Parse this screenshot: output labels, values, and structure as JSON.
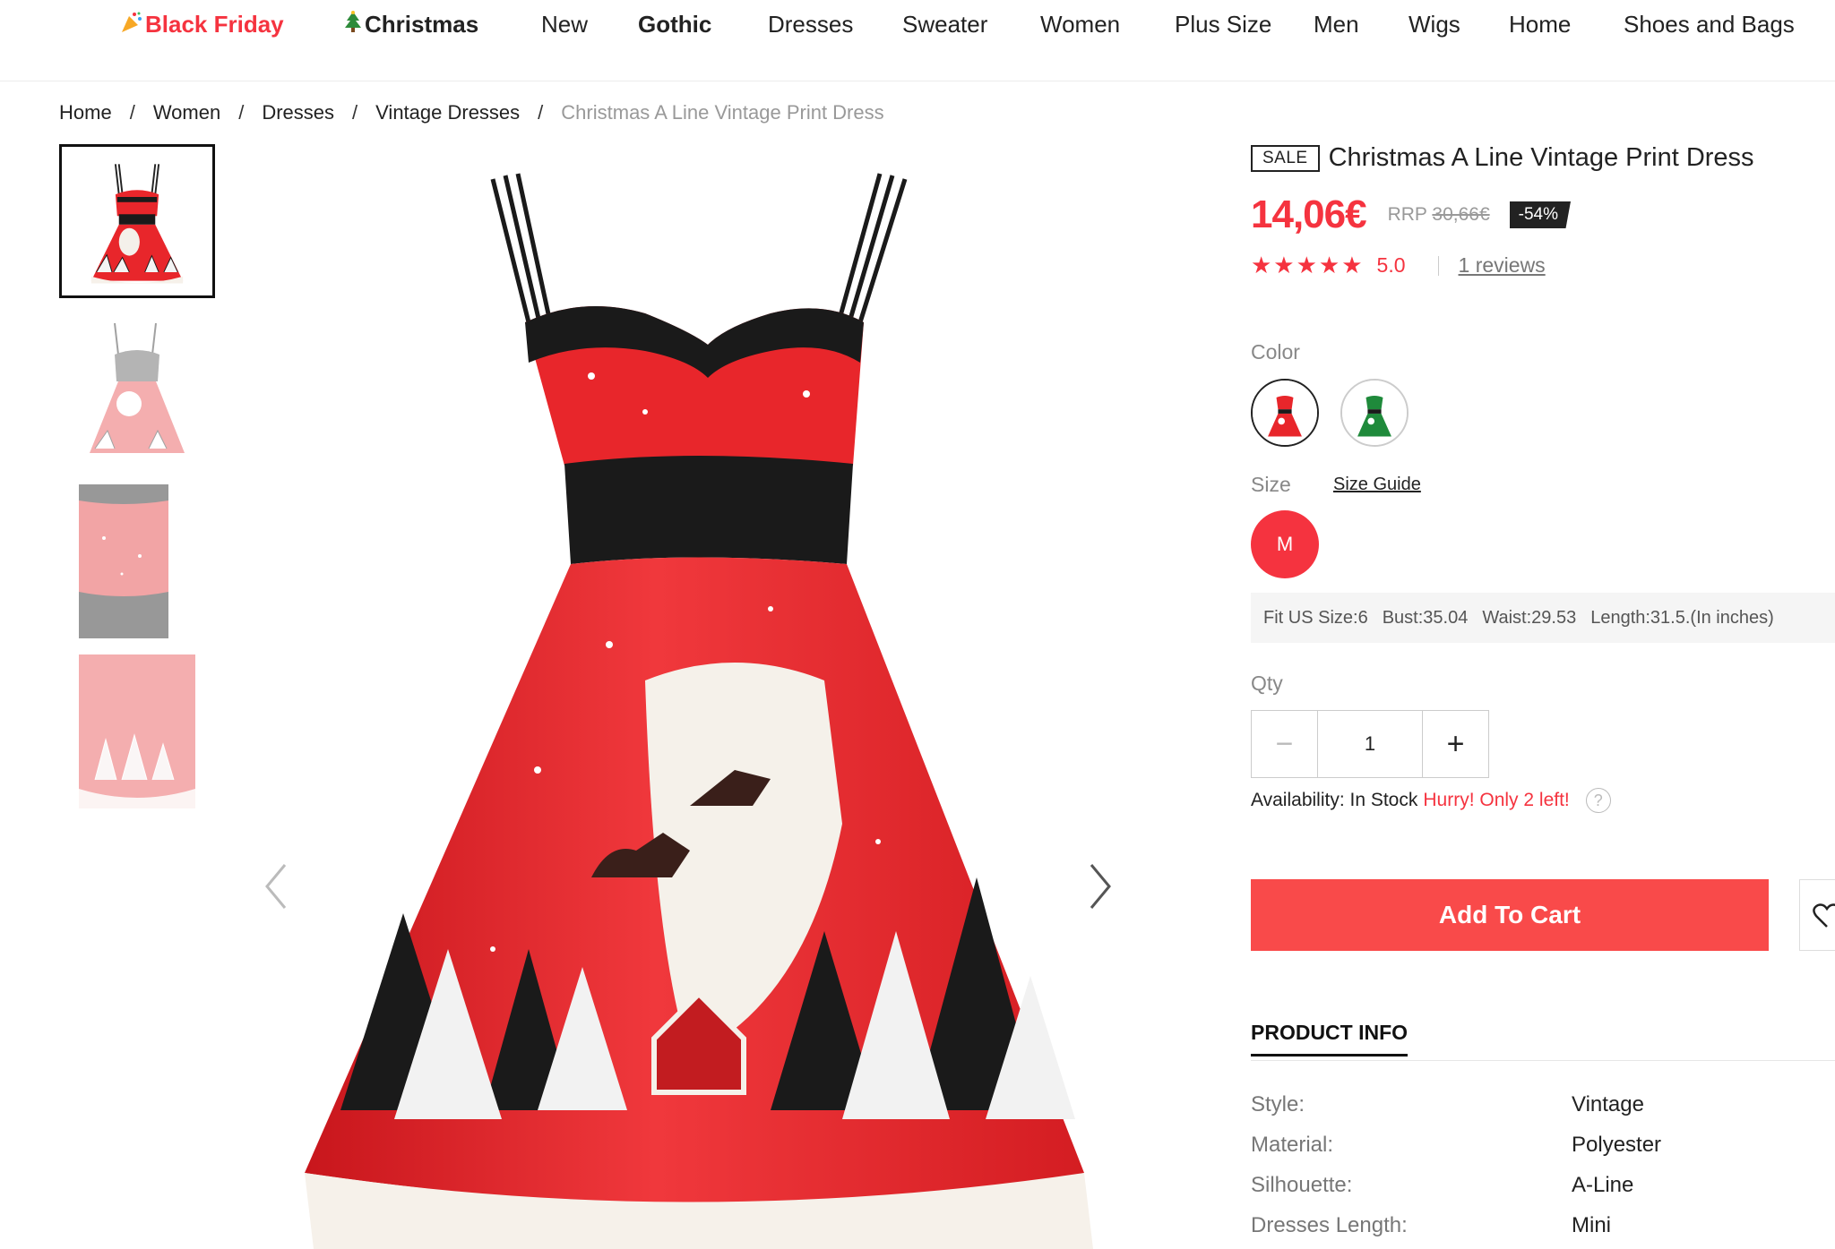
{
  "nav": {
    "items": [
      {
        "label": "Black Friday",
        "icon": "party-popper-icon"
      },
      {
        "label": "Christmas",
        "icon": "christmas-tree-icon"
      },
      {
        "label": "New"
      },
      {
        "label": "Gothic"
      },
      {
        "label": "Dresses"
      },
      {
        "label": "Sweater"
      },
      {
        "label": "Women"
      },
      {
        "label": "Plus Size"
      },
      {
        "label": "Men"
      },
      {
        "label": "Wigs"
      },
      {
        "label": "Home"
      },
      {
        "label": "Shoes and Bags"
      }
    ]
  },
  "breadcrumb": {
    "items": [
      "Home",
      "Women",
      "Dresses",
      "Vintage Dresses"
    ],
    "current": "Christmas A Line Vintage Print Dress",
    "separator": "/"
  },
  "gallery": {
    "prev_icon": "chevron-left-icon",
    "next_icon": "chevron-right-icon"
  },
  "product": {
    "badge": "SALE",
    "title": "Christmas A Line Vintage Print Dress",
    "price": "14,06€",
    "rrp_label": "RRP",
    "rrp_value": "30,66€",
    "discount": "-54%",
    "stars": "★★★★★",
    "rating": "5.0",
    "reviews": "1 reviews",
    "color_label": "Color",
    "colors": [
      "red",
      "green"
    ],
    "size_label": "Size",
    "size_guide": "Size Guide",
    "selected_size": "M",
    "size_info": [
      "Fit US Size:6",
      "Bust:35.04",
      "Waist:29.53",
      "Length:31.5.(In inches)"
    ],
    "qty_label": "Qty",
    "qty_value": "1",
    "qty_minus": "−",
    "qty_plus": "+",
    "availability_label": "Availability: In Stock",
    "availability_hurry": "Hurry! Only 2 left!",
    "help_symbol": "?",
    "add_to_cart": "Add To Cart",
    "info_tab": "PRODUCT INFO",
    "specs": [
      {
        "key": "Style:",
        "value": "Vintage"
      },
      {
        "key": "Material:",
        "value": "Polyester"
      },
      {
        "key": "Silhouette:",
        "value": "A-Line"
      },
      {
        "key": "Dresses Length:",
        "value": "Mini"
      }
    ]
  },
  "colors": {
    "accent": "#f5333f",
    "cart": "#f94a4a",
    "dress_red": "#e8262b",
    "dress_black": "#1a1a1a"
  }
}
